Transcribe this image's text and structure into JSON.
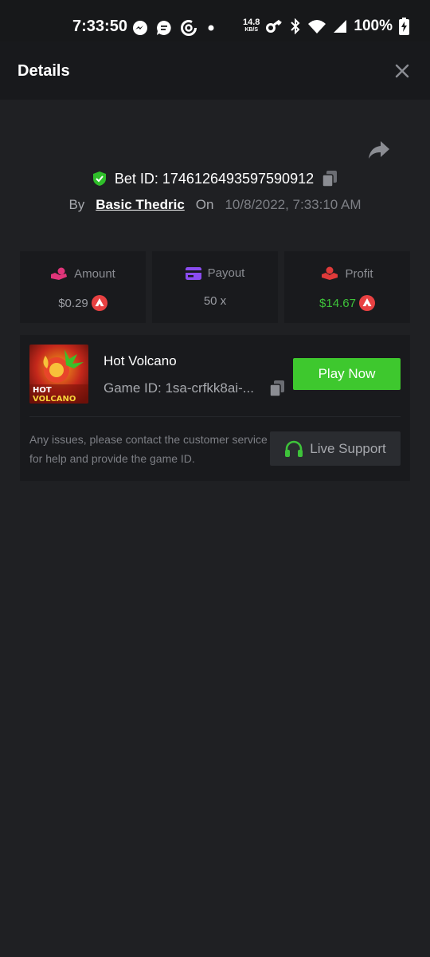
{
  "status_bar": {
    "time": "7:33:50",
    "net_speed_value": "14.8",
    "net_speed_unit": "KB/S",
    "battery": "100%",
    "icons": [
      "messenger-icon",
      "chat-bubble-icon",
      "app-ring-icon",
      "dot-icon",
      "key-icon",
      "bluetooth-icon",
      "wifi-icon",
      "signal-icon",
      "battery-charging-icon"
    ]
  },
  "header": {
    "title": "Details",
    "close_icon": "close-icon"
  },
  "bet": {
    "id_text": "Bet ID: 1746126493597590912",
    "by_label": "By",
    "user": "Basic Thedric",
    "on_label": "On",
    "date": "10/8/2022, 7:33:10 AM"
  },
  "stats": [
    {
      "label": "Amount",
      "value": "$0.29",
      "icon": "hand-coins-icon",
      "currency_icon": "avax-icon"
    },
    {
      "label": "Payout",
      "value": "50 x",
      "icon": "card-icon"
    },
    {
      "label": "Profit",
      "value": "$14.67",
      "icon": "hand-money-icon",
      "currency_icon": "avax-icon"
    }
  ],
  "game": {
    "name": "Hot Volcano",
    "id_text": "Game ID: 1sa-crfkk8ai-...",
    "thumb_line1": "HOT",
    "thumb_line2": "VOLCANO",
    "play_label": "Play Now"
  },
  "support": {
    "message": "Any issues, please contact the customer service for help and provide the game ID.",
    "button_label": "Live Support"
  },
  "colors": {
    "background": "#1f2023",
    "card": "#191a1d",
    "accent_green": "#3ec82e",
    "amount_icon": "#e0357a",
    "payout_icon": "#8a4cf0",
    "profit_icon": "#e03a3a",
    "avax_red": "#e84142"
  }
}
